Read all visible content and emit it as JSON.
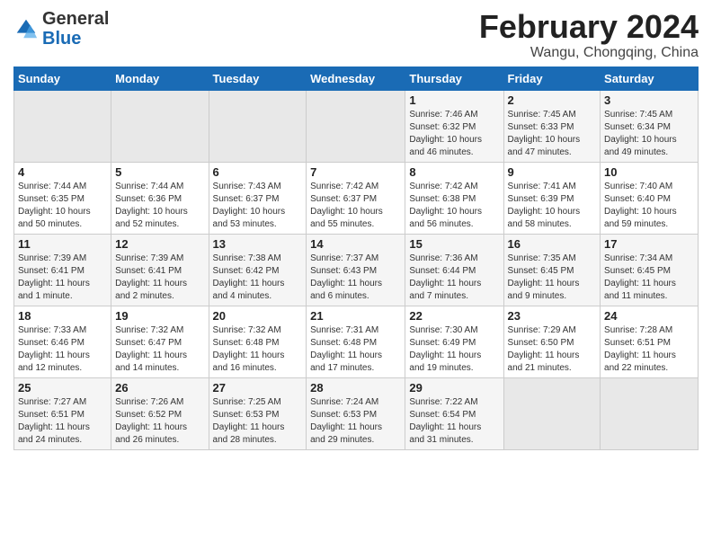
{
  "header": {
    "logo_general": "General",
    "logo_blue": "Blue",
    "main_title": "February 2024",
    "subtitle": "Wangu, Chongqing, China"
  },
  "weekdays": [
    "Sunday",
    "Monday",
    "Tuesday",
    "Wednesday",
    "Thursday",
    "Friday",
    "Saturday"
  ],
  "weeks": [
    [
      {
        "day": "",
        "info": ""
      },
      {
        "day": "",
        "info": ""
      },
      {
        "day": "",
        "info": ""
      },
      {
        "day": "",
        "info": ""
      },
      {
        "day": "1",
        "info": "Sunrise: 7:46 AM\nSunset: 6:32 PM\nDaylight: 10 hours\nand 46 minutes."
      },
      {
        "day": "2",
        "info": "Sunrise: 7:45 AM\nSunset: 6:33 PM\nDaylight: 10 hours\nand 47 minutes."
      },
      {
        "day": "3",
        "info": "Sunrise: 7:45 AM\nSunset: 6:34 PM\nDaylight: 10 hours\nand 49 minutes."
      }
    ],
    [
      {
        "day": "4",
        "info": "Sunrise: 7:44 AM\nSunset: 6:35 PM\nDaylight: 10 hours\nand 50 minutes."
      },
      {
        "day": "5",
        "info": "Sunrise: 7:44 AM\nSunset: 6:36 PM\nDaylight: 10 hours\nand 52 minutes."
      },
      {
        "day": "6",
        "info": "Sunrise: 7:43 AM\nSunset: 6:37 PM\nDaylight: 10 hours\nand 53 minutes."
      },
      {
        "day": "7",
        "info": "Sunrise: 7:42 AM\nSunset: 6:37 PM\nDaylight: 10 hours\nand 55 minutes."
      },
      {
        "day": "8",
        "info": "Sunrise: 7:42 AM\nSunset: 6:38 PM\nDaylight: 10 hours\nand 56 minutes."
      },
      {
        "day": "9",
        "info": "Sunrise: 7:41 AM\nSunset: 6:39 PM\nDaylight: 10 hours\nand 58 minutes."
      },
      {
        "day": "10",
        "info": "Sunrise: 7:40 AM\nSunset: 6:40 PM\nDaylight: 10 hours\nand 59 minutes."
      }
    ],
    [
      {
        "day": "11",
        "info": "Sunrise: 7:39 AM\nSunset: 6:41 PM\nDaylight: 11 hours\nand 1 minute."
      },
      {
        "day": "12",
        "info": "Sunrise: 7:39 AM\nSunset: 6:41 PM\nDaylight: 11 hours\nand 2 minutes."
      },
      {
        "day": "13",
        "info": "Sunrise: 7:38 AM\nSunset: 6:42 PM\nDaylight: 11 hours\nand 4 minutes."
      },
      {
        "day": "14",
        "info": "Sunrise: 7:37 AM\nSunset: 6:43 PM\nDaylight: 11 hours\nand 6 minutes."
      },
      {
        "day": "15",
        "info": "Sunrise: 7:36 AM\nSunset: 6:44 PM\nDaylight: 11 hours\nand 7 minutes."
      },
      {
        "day": "16",
        "info": "Sunrise: 7:35 AM\nSunset: 6:45 PM\nDaylight: 11 hours\nand 9 minutes."
      },
      {
        "day": "17",
        "info": "Sunrise: 7:34 AM\nSunset: 6:45 PM\nDaylight: 11 hours\nand 11 minutes."
      }
    ],
    [
      {
        "day": "18",
        "info": "Sunrise: 7:33 AM\nSunset: 6:46 PM\nDaylight: 11 hours\nand 12 minutes."
      },
      {
        "day": "19",
        "info": "Sunrise: 7:32 AM\nSunset: 6:47 PM\nDaylight: 11 hours\nand 14 minutes."
      },
      {
        "day": "20",
        "info": "Sunrise: 7:32 AM\nSunset: 6:48 PM\nDaylight: 11 hours\nand 16 minutes."
      },
      {
        "day": "21",
        "info": "Sunrise: 7:31 AM\nSunset: 6:48 PM\nDaylight: 11 hours\nand 17 minutes."
      },
      {
        "day": "22",
        "info": "Sunrise: 7:30 AM\nSunset: 6:49 PM\nDaylight: 11 hours\nand 19 minutes."
      },
      {
        "day": "23",
        "info": "Sunrise: 7:29 AM\nSunset: 6:50 PM\nDaylight: 11 hours\nand 21 minutes."
      },
      {
        "day": "24",
        "info": "Sunrise: 7:28 AM\nSunset: 6:51 PM\nDaylight: 11 hours\nand 22 minutes."
      }
    ],
    [
      {
        "day": "25",
        "info": "Sunrise: 7:27 AM\nSunset: 6:51 PM\nDaylight: 11 hours\nand 24 minutes."
      },
      {
        "day": "26",
        "info": "Sunrise: 7:26 AM\nSunset: 6:52 PM\nDaylight: 11 hours\nand 26 minutes."
      },
      {
        "day": "27",
        "info": "Sunrise: 7:25 AM\nSunset: 6:53 PM\nDaylight: 11 hours\nand 28 minutes."
      },
      {
        "day": "28",
        "info": "Sunrise: 7:24 AM\nSunset: 6:53 PM\nDaylight: 11 hours\nand 29 minutes."
      },
      {
        "day": "29",
        "info": "Sunrise: 7:22 AM\nSunset: 6:54 PM\nDaylight: 11 hours\nand 31 minutes."
      },
      {
        "day": "",
        "info": ""
      },
      {
        "day": "",
        "info": ""
      }
    ]
  ]
}
